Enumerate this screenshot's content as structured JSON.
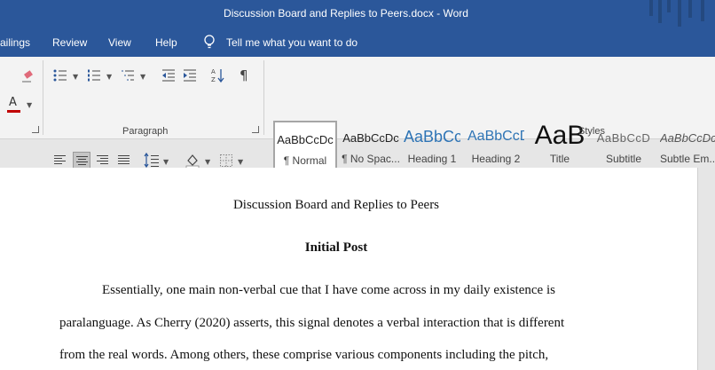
{
  "window": {
    "title": "Discussion Board and Replies to Peers.docx  -  Word"
  },
  "menu": {
    "tabs": [
      "ailings",
      "Review",
      "View",
      "Help"
    ],
    "tell_me": "Tell me what you want to do"
  },
  "ribbon": {
    "groups": {
      "paragraph": "Paragraph",
      "styles": "Styles"
    },
    "styles": [
      {
        "sample": "AaBbCcDc",
        "name": "¶ Normal"
      },
      {
        "sample": "AaBbCcDc",
        "name": "¶ No Spac..."
      },
      {
        "sample": "AaBbCc",
        "name": "Heading 1"
      },
      {
        "sample": "AaBbCcD",
        "name": "Heading 2"
      },
      {
        "sample": "AaB",
        "name": "Title"
      },
      {
        "sample": "AaBbCcD",
        "name": "Subtitle"
      },
      {
        "sample": "AaBbCcDc",
        "name": "Subtle Em..."
      }
    ],
    "active_alignment": "center",
    "colors": {
      "brand": "#2b579a",
      "font_color": "#c00000",
      "heading_color": "#2e74b5"
    }
  },
  "document": {
    "title": "Discussion Board and Replies to Peers",
    "heading": "Initial Post",
    "lines": [
      "Essentially, one main non-verbal cue that I have come across in my daily existence is",
      "paralanguage. As Cherry (2020) asserts, this signal denotes a verbal interaction that is different",
      "from the real words. Among others, these comprise various components including the pitch,"
    ]
  }
}
